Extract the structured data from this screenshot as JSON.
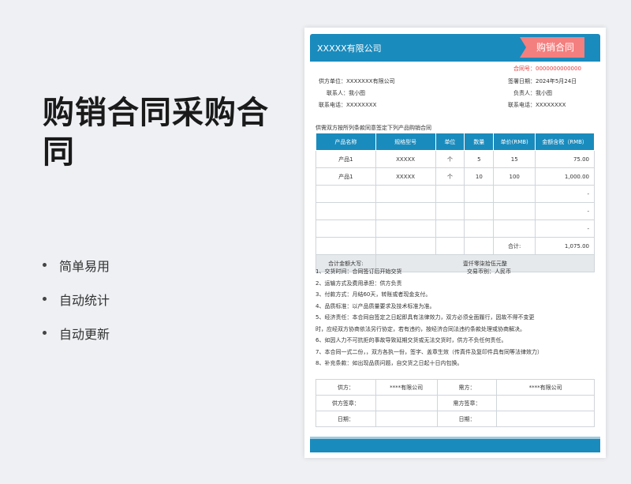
{
  "promo": {
    "title": "购销合同采购合同",
    "features": [
      "简单易用",
      "自动统计",
      "自动更新"
    ]
  },
  "doc": {
    "company": "XXXXX有限公司",
    "badge": "购销合同",
    "contract_no": "合同号：0000000000000",
    "supplier": "供方单位：XXXXXXX有限公司",
    "sign_date": "签署日期：2024年5月24日",
    "contact": "联系人：我小图",
    "owner": "负责人：我小图",
    "phone_left": "联系电话：XXXXXXXX",
    "phone_right": "联系电话：XXXXXXXX",
    "intro": "供需双方按所列条款同意签定下列产品购销合同",
    "columns": [
      "产品名称",
      "规格型号",
      "单位",
      "数量",
      "单价(RMB)",
      "金额含税（RMB）"
    ],
    "rows": [
      [
        "产品1",
        "XXXXX",
        "个",
        "5",
        "15",
        "75.00"
      ],
      [
        "产品1",
        "XXXXX",
        "个",
        "10",
        "100",
        "1,000.00"
      ],
      [
        "",
        "",
        "",
        "",
        "",
        "-"
      ],
      [
        "",
        "",
        "",
        "",
        "",
        "-"
      ],
      [
        "",
        "",
        "",
        "",
        "",
        "-"
      ]
    ],
    "subtotal_label": "合计:",
    "subtotal_value": "1,075.00",
    "total_label": "合计金额大写:",
    "total_words": "壹仟零柒拾伍元整",
    "terms": [
      "1、交货时间：合同签订后开始交货",
      "2、运输方式及费用承担：供方负责",
      "3、付款方式：月结60天，转账或者现金支付。",
      "4、品质标准：以产品质量要求及技术标准为准。",
      "5、经济责任：本合同自签定之日起即具有法律效力，双方必须全面履行，因故不得不变更",
      "时，应经双方协商依法另行协定，若有违约，按经济合同法违约条款处理或协商解决。",
      "6、如因人力不可抗拒的事故导致延期交货或无法交货时，供方不负任何责任。",
      "7、本合同一式二份，，双方各执一份，签字、盖章生效（传真件及复印件具有同等法律效力）",
      "8、补充条款：如出现品质问题，自交货之日起十日内包换。"
    ],
    "currency": "交易币别：人民币",
    "sign": {
      "supplier_label": "供方：",
      "supplier_value": "****有限公司",
      "buyer_label": "需方：",
      "buyer_value": "****有限公司",
      "supplier_sign": "供方签章：",
      "buyer_sign": "需方签章：",
      "date_label_left": "日期：",
      "date_label_right": "日期："
    }
  }
}
